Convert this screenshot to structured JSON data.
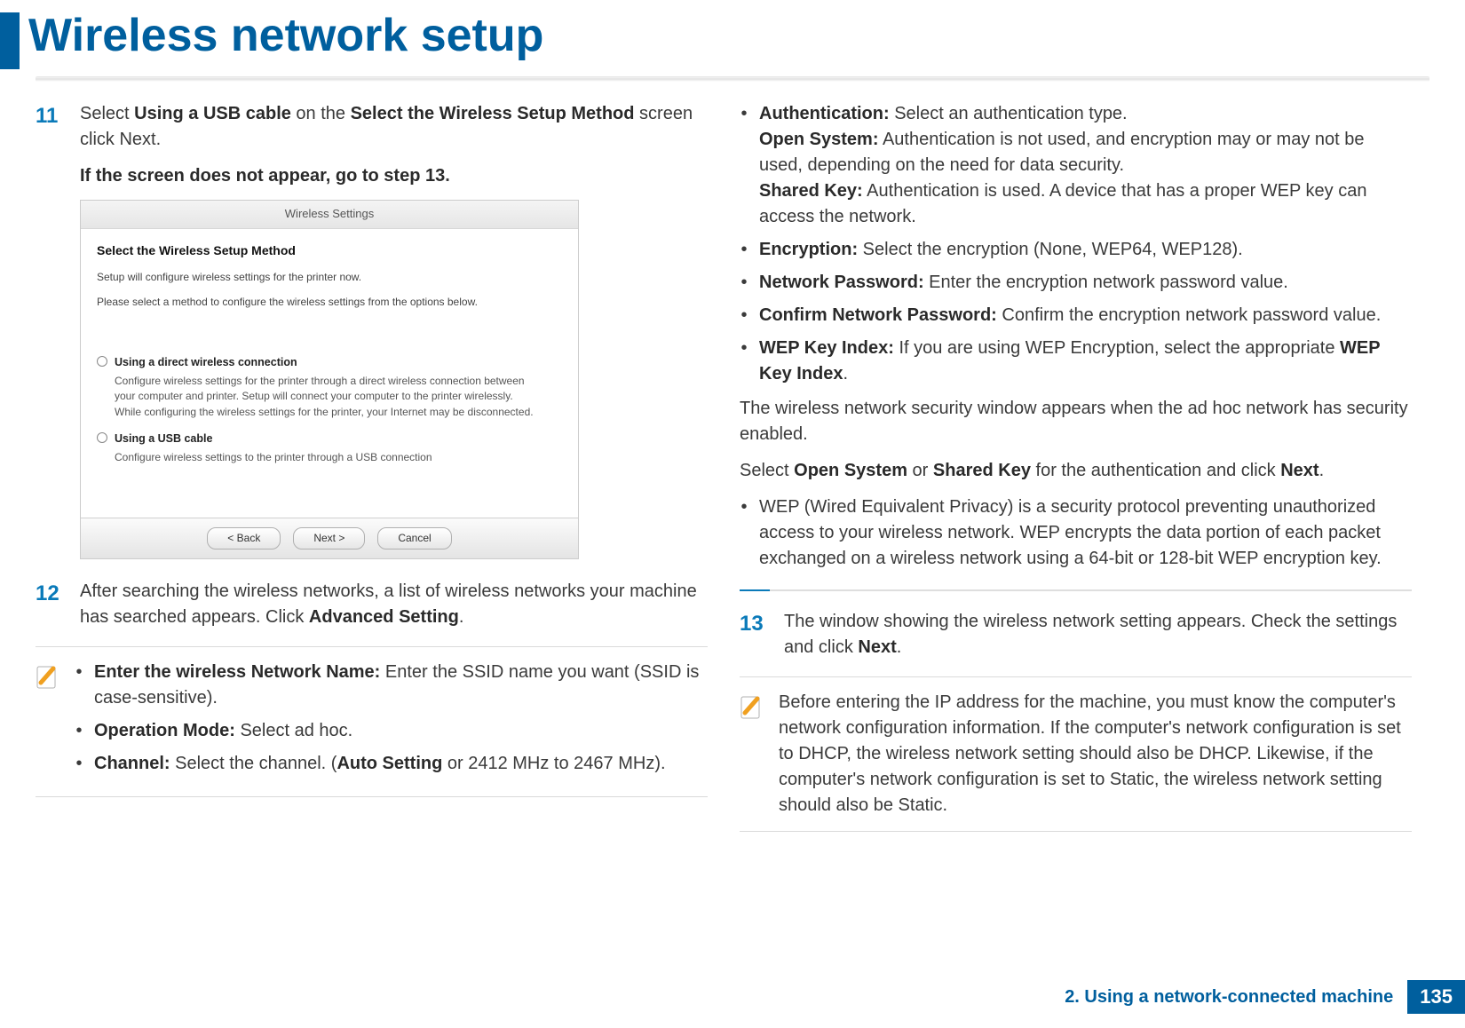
{
  "header": {
    "title": "Wireless network setup"
  },
  "steps": {
    "s11_num": "11",
    "s11_a": "Select ",
    "s11_b": "Using a USB cable",
    "s11_c": " on the ",
    "s11_d": "Select the Wireless Setup Method",
    "s11_e": " screen click Next.",
    "s11_warn_a": "If the screen does not appear, go to step 13",
    "s11_warn_b": ".",
    "s12_num": "12",
    "s12_a": "After searching the wireless networks, a list of wireless networks your machine has searched appears. Click ",
    "s12_b": "Advanced Setting",
    "s12_c": ".",
    "s13_num": "13",
    "s13_a": "The window showing the wireless network setting appears. Check the settings and click ",
    "s13_b": "Next",
    "s13_c": "."
  },
  "dialog": {
    "title": "Wireless Settings",
    "heading": "Select the Wireless Setup Method",
    "sub1": "Setup will configure wireless settings for the printer now.",
    "sub2": "Please select a method to configure the wireless settings from the options below.",
    "opt1_label": "Using a direct wireless connection",
    "opt1_desc": "Configure wireless settings for the printer through a direct wireless connection between your computer and printer. Setup will connect your computer to the printer wirelessly.\nWhile configuring the wireless settings for the printer, your Internet may be disconnected.",
    "opt2_label": "Using a USB cable",
    "opt2_desc": "Configure wireless settings to the printer through a USB connection",
    "btn_back": "<  Back",
    "btn_next": "Next  >",
    "btn_cancel": "Cancel"
  },
  "note12": {
    "b1_a": "Enter the wireless Network Name:",
    "b1_b": " Enter the SSID name you want (SSID is case-sensitive).",
    "b2_a": "Operation Mode:",
    "b2_b": " Select ad hoc.",
    "b3_a": "Channel:",
    "b3_b": " Select the channel. (",
    "b3_c": "Auto Setting",
    "b3_d": " or 2412 MHz to 2467 MHz)."
  },
  "col2": {
    "b_auth_a": "Authentication:",
    "b_auth_b": " Select an authentication type.",
    "b_open_a": "Open System:",
    "b_open_b": " Authentication is not used, and encryption may or may not be used, depending on the need for data security.",
    "b_shared_a": "Shared Key:",
    "b_shared_b": " Authentication is used. A device that has a proper WEP key can access the network.",
    "b_enc_a": "Encryption:",
    "b_enc_b": " Select the encryption (None, WEP64, WEP128).",
    "b_np_a": "Network Password:",
    "b_np_b": " Enter the encryption network password value.",
    "b_cnp_a": "Confirm Network Password:",
    "b_cnp_b": " Confirm the encryption network password value.",
    "b_wep_a": "WEP Key Index:",
    "b_wep_b": " If you are using WEP Encryption, select the appropriate ",
    "b_wep_c": "WEP Key Index",
    "b_wep_d": ".",
    "p1": "The wireless network security window appears when the ad hoc network has security enabled.",
    "p2_a": "Select ",
    "p2_b": "Open System",
    "p2_c": " or ",
    "p2_d": "Shared Key",
    "p2_e": " for the authentication and click ",
    "p2_f": "Next",
    "p2_g": ".",
    "b_wepdesc": "WEP (Wired Equivalent Privacy) is a security protocol preventing unauthorized access to your wireless network. WEP encrypts the data portion of each packet exchanged on a wireless network using a 64-bit or 128-bit WEP encryption key."
  },
  "note13": {
    "text": "Before entering the IP address for the machine, you must know the computer's network configuration information. If the computer's network configuration is set to DHCP, the wireless network setting should also be DHCP. Likewise, if the computer's network configuration is set to Static, the wireless network setting should also be Static."
  },
  "footer": {
    "chapter": "2.  Using a network-connected machine",
    "page": "135"
  }
}
